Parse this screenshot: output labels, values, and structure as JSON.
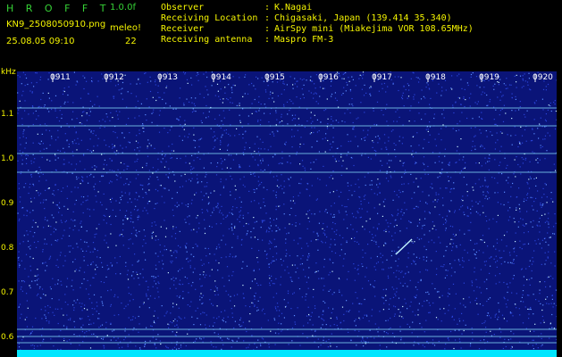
{
  "header": {
    "app_name": "H R O F F T",
    "version": "1.0.0f",
    "filename": "KN9_2508050910.png",
    "datetime": "25.08.05 09:10",
    "meleo_label": "meleo!",
    "count": "22"
  },
  "info": [
    {
      "label": "Observer",
      "value": "K.Nagai"
    },
    {
      "label": "Receiving Location",
      "value": "Chigasaki, Japan (139.414 35.340)"
    },
    {
      "label": "Receiver",
      "value": "AirSpy mini (Miakejima VOR 108.65MHz)"
    },
    {
      "label": "Receiving antenna",
      "value": "Maspro FM-3"
    }
  ],
  "axis": {
    "unit": "kHz",
    "y_ticks": [
      "1.1",
      "1.0",
      "0.9",
      "0.8",
      "0.7",
      "0.6"
    ],
    "x_ticks": [
      "0911",
      "0912",
      "0913",
      "0914",
      "0915",
      "0916",
      "0917",
      "0918",
      "0919",
      "0920"
    ]
  },
  "colors": {
    "background": "#000000",
    "plot_background": "#0a1478",
    "noise": "#3c64ff",
    "lines": "#8ce6ff",
    "text_yellow": "#f4f400",
    "title_green": "#36d236",
    "bottom_bar": "#00e6ff"
  }
}
